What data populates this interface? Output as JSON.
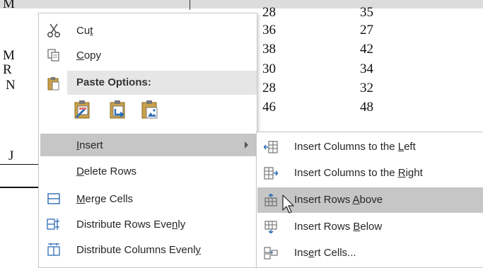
{
  "document": {
    "left_letters": [
      "M",
      "M",
      "R",
      "N",
      "J"
    ],
    "col3": [
      "28",
      "36",
      "38",
      "30",
      "28",
      "46"
    ],
    "col4": [
      "35",
      "27",
      "42",
      "34",
      "32",
      "48"
    ]
  },
  "context_menu": {
    "cut": {
      "pre": "Cu",
      "key": "t",
      "post": ""
    },
    "copy": {
      "pre": "",
      "key": "C",
      "post": "opy"
    },
    "paste_options_label": "Paste Options:",
    "insert": {
      "pre": "",
      "key": "I",
      "post": "nsert"
    },
    "delete_rows": {
      "pre": "",
      "key": "D",
      "post": "elete Rows"
    },
    "merge_cells": {
      "pre": "",
      "key": "M",
      "post": "erge Cells"
    },
    "distribute_rows": {
      "pre": "Distribute Rows Eve",
      "key": "n",
      "post": "ly"
    },
    "distribute_columns": {
      "pre": "Distribute Columns Evenl",
      "key": "y",
      "post": ""
    }
  },
  "insert_submenu": {
    "cols_left": {
      "pre": "Insert Columns to the ",
      "key": "L",
      "post": "eft"
    },
    "cols_right": {
      "pre": "Insert Columns to the ",
      "key": "R",
      "post": "ight"
    },
    "rows_above": {
      "pre": "Insert Rows ",
      "key": "A",
      "post": "bove"
    },
    "rows_below": {
      "pre": "Insert Rows ",
      "key": "B",
      "post": "elow"
    },
    "cells": {
      "pre": "Ins",
      "key": "e",
      "post": "rt Cells..."
    }
  },
  "colors": {
    "highlight": "#c6c6c6",
    "icon_blue": "#2f6db5",
    "clipboard_gold": "#c9a14a"
  }
}
